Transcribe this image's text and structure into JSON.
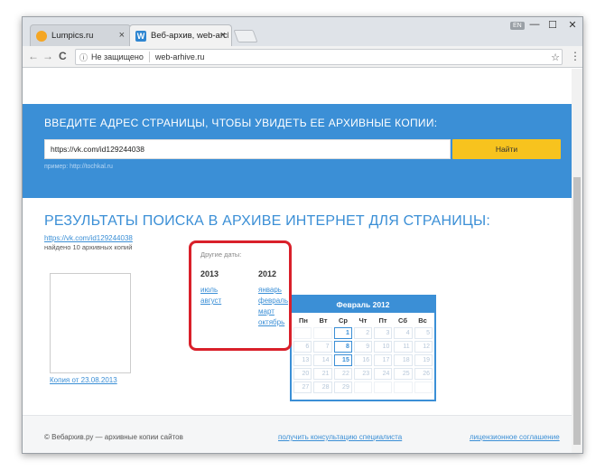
{
  "browser": {
    "tabs": [
      {
        "title": "Lumpics.ru",
        "close": "×"
      },
      {
        "title": "Веб-архив, web-archive",
        "close": "×"
      }
    ],
    "lang_badge": "EN",
    "controls": {
      "minimize": "—",
      "maximize": "☐",
      "close": "✕"
    },
    "address": {
      "security": "Не защищено",
      "url": "web-arhive.ru"
    },
    "nav": {
      "back": "←",
      "forward": "→",
      "reload": "C"
    }
  },
  "hero": {
    "title": "ВВЕДИТЕ АДРЕС СТРАНИЦЫ, ЧТОБЫ УВИДЕТЬ ЕЕ АРХИВНЫЕ КОПИИ:",
    "input_value": "https://vk.com/id129244038",
    "button_label": "Найти",
    "hint": "пример: http://tochkal.ru"
  },
  "results": {
    "title": "РЕЗУЛЬТАТЫ ПОИСКА В АРХИВЕ ИНТЕРНЕТ ДЛЯ СТРАНИЦЫ:",
    "link": "https://vk.com/id129244038",
    "count": "найдено 10 архивных копий",
    "copy_link": "Копия от 23.08.2013"
  },
  "other_dates": {
    "label": "Другие даты:",
    "years": [
      {
        "year": "2013",
        "months": [
          "июль",
          "август"
        ]
      },
      {
        "year": "2012",
        "months": [
          "январь",
          "февраль",
          "март",
          "октябрь"
        ]
      }
    ]
  },
  "calendar": {
    "title": "Февраль 2012",
    "weekdays": [
      "Пн",
      "Вт",
      "Ср",
      "Чт",
      "Пт",
      "Сб",
      "Вс"
    ],
    "days": [
      "",
      "",
      "1",
      "2",
      "3",
      "4",
      "5",
      "6",
      "7",
      "8",
      "9",
      "10",
      "11",
      "12",
      "13",
      "14",
      "15",
      "16",
      "17",
      "18",
      "19",
      "20",
      "21",
      "22",
      "23",
      "24",
      "25",
      "26",
      "27",
      "28",
      "29",
      "",
      "",
      "",
      ""
    ],
    "highlighted": [
      "1",
      "8",
      "15"
    ]
  },
  "footer": {
    "copyright": "© Вебархив.ру — архивные копии сайтов",
    "consult": "получить консультацию специалиста",
    "license": "лицензионное соглашение"
  }
}
